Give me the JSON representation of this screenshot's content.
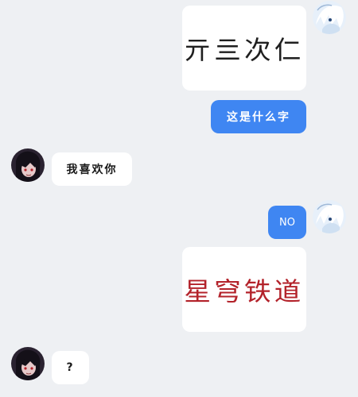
{
  "messages": {
    "m1_text": "亓亖次仁",
    "m2_text": "这是什么字",
    "m3_text": "我喜欢你",
    "m4_text": "NO",
    "m5_text": "星穹铁道",
    "m6_text": "?"
  },
  "colors": {
    "background": "#eef0f3",
    "bubble_white": "#ffffff",
    "bubble_blue": "#3f86f2",
    "red_ink": "#b3222a"
  },
  "icons": {
    "self_avatar": "white-haired-anime-avatar",
    "other_avatar": "dark-haired-anime-avatar"
  }
}
